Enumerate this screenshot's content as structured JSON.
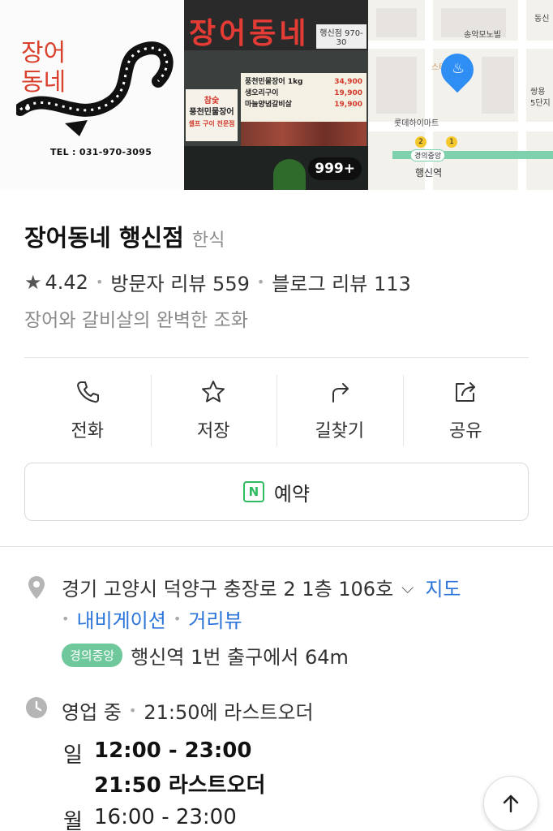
{
  "photos": {
    "logo_text_line1": "장어",
    "logo_text_line2": "동네",
    "logo_tel": "TEL : 031-970-3095",
    "sign_title": "장어동네",
    "sign_side": "행신점 970-30",
    "left_board_line1": "참숯",
    "left_board_line2": "풍천민물장어",
    "left_board_line3": "셀프 구이 전문점",
    "menu": [
      {
        "name": "풍천민물장어 1kg",
        "price": "34,900"
      },
      {
        "name": "생오리구이",
        "price": "19,900"
      },
      {
        "name": "마늘양념갈비살",
        "price": "19,900"
      }
    ],
    "photo_count": "999+",
    "map_labels": {
      "karaoke": "송악모노빌",
      "mart": "롯데하이마트",
      "rail_line": "경의중앙",
      "station": "행신역",
      "right1": "동신",
      "right2": "쌍용",
      "right3": "5단지",
      "cafe": "스타"
    }
  },
  "place": {
    "name": "장어동네 행신점",
    "category": "한식",
    "rating": "4.42",
    "visitor_reviews": "방문자 리뷰 559",
    "blog_reviews": "블로그 리뷰 113",
    "description": "장어와 갈비살의 완벽한 조화"
  },
  "actions": [
    {
      "label": "전화",
      "icon": "phone-icon"
    },
    {
      "label": "저장",
      "icon": "star-outline-icon"
    },
    {
      "label": "길찾기",
      "icon": "directions-arrow-icon"
    },
    {
      "label": "공유",
      "icon": "share-icon"
    }
  ],
  "reserve": {
    "label": "예약",
    "icon": "naver-booking-icon"
  },
  "info": {
    "address": "경기 고양시 덕양구 충장로 2 1층 106호",
    "map_link": "지도",
    "navigation_link": "내비게이션",
    "street_view_link": "거리뷰",
    "line_badge": "경의중앙",
    "transit_text": "행신역 1번 출구에서 64m",
    "status": "영업 중",
    "last_order_note": "21:50에 라스트오더",
    "hours": [
      {
        "day": "일",
        "time": "12:00 - 23:00",
        "last_order": "21:50 라스트오더"
      },
      {
        "day": "월",
        "time": "16:00 - 23:00"
      }
    ]
  },
  "colors": {
    "accent_blue": "#2a74d9",
    "line_green": "#6fc89b",
    "naver_green": "#2fbb5f"
  }
}
